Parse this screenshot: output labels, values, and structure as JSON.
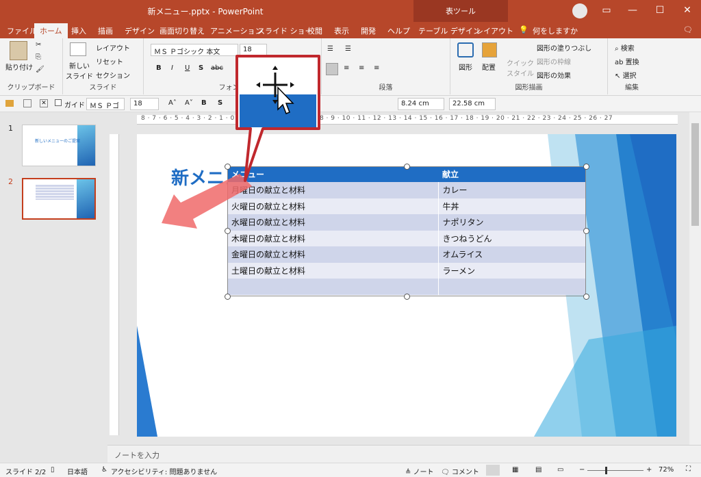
{
  "window": {
    "title": "新メニュー.pptx  -  PowerPoint",
    "context_group": "表ツール",
    "min_icon": "minimize-icon",
    "max_icon": "maximize-icon",
    "close_icon": "close-icon"
  },
  "tabs": [
    "ファイル",
    "ホーム",
    "挿入",
    "描画",
    "デザイン",
    "画面切り替え",
    "アニメーション",
    "スライド ショー",
    "校閲",
    "表示",
    "開発",
    "ヘルプ",
    "テーブル デザイン",
    "レイアウト"
  ],
  "active_tab": "ホーム",
  "tell_me": "何をしますか",
  "ribbon": {
    "clipboard": {
      "paste": "貼り付け",
      "label": "クリップボード"
    },
    "slides": {
      "new_slide": "新しい\nスライド",
      "layout": "レイアウト",
      "reset": "リセット",
      "section": "セクション",
      "label": "スライド"
    },
    "font": {
      "font_name": "ＭＳ Ｐゴシック 本文",
      "font_size": "18",
      "bold": "B",
      "italic": "I",
      "underline": "U",
      "shadow": "S",
      "strike": "abc",
      "label": "フォント"
    },
    "paragraph": {
      "label": "段落"
    },
    "drawing": {
      "shape": "図形",
      "arrange": "配置",
      "quick_style": "クイック\nスタイル",
      "fill": "図形の塗りつぶし",
      "outline": "図形の枠線",
      "effects": "図形の効果",
      "label": "図形描画"
    },
    "editing": {
      "find": "検索",
      "replace": "置換",
      "select": "選択",
      "label": "編集"
    }
  },
  "qat": {
    "guide": "ガイド",
    "font_name": "ＭＳ Ｐゴ",
    "font_size": "18",
    "height": "8.24 cm",
    "width": "22.58 cm"
  },
  "ruler_text": "8 · 7 · 6 · 5 · 4 · 3 · 2 · 1 · 0 · 1 · 2 · 3 · 4 · 5 · 6 · 7 · 8 · 9 · 10 · 11 · 12 · 13 · 14 · 15 · 16 · 17 · 18 · 19 · 20 · 21 · 22 · 23 · 24 · 25 · 26 · 27",
  "thumbnails": [
    {
      "number": "1",
      "title": "新しいメニューのご提案"
    },
    {
      "number": "2",
      "title": ""
    }
  ],
  "slide": {
    "title": "新メニュー",
    "table": {
      "headers": [
        "メニュー",
        "献立"
      ],
      "rows": [
        [
          "月曜日の献立と材料",
          "カレー"
        ],
        [
          "火曜日の献立と材料",
          "牛丼"
        ],
        [
          "水曜日の献立と材料",
          "ナポリタン"
        ],
        [
          "木曜日の献立と材料",
          "きつねうどん"
        ],
        [
          "金曜日の献立と材料",
          "オムライス"
        ],
        [
          "土曜日の献立と材料",
          "ラーメン"
        ],
        [
          "",
          ""
        ]
      ]
    }
  },
  "notes_placeholder": "ノートを入力",
  "status": {
    "slide": "スライド 2/2",
    "language": "日本語",
    "accessibility": "アクセシビリティ: 問題ありません",
    "notes": "ノート",
    "comments": "コメント",
    "zoom": "72%"
  },
  "colors": {
    "accent": "#b7472a",
    "table_header": "#1f6dc4",
    "callout": "#c0282d"
  }
}
